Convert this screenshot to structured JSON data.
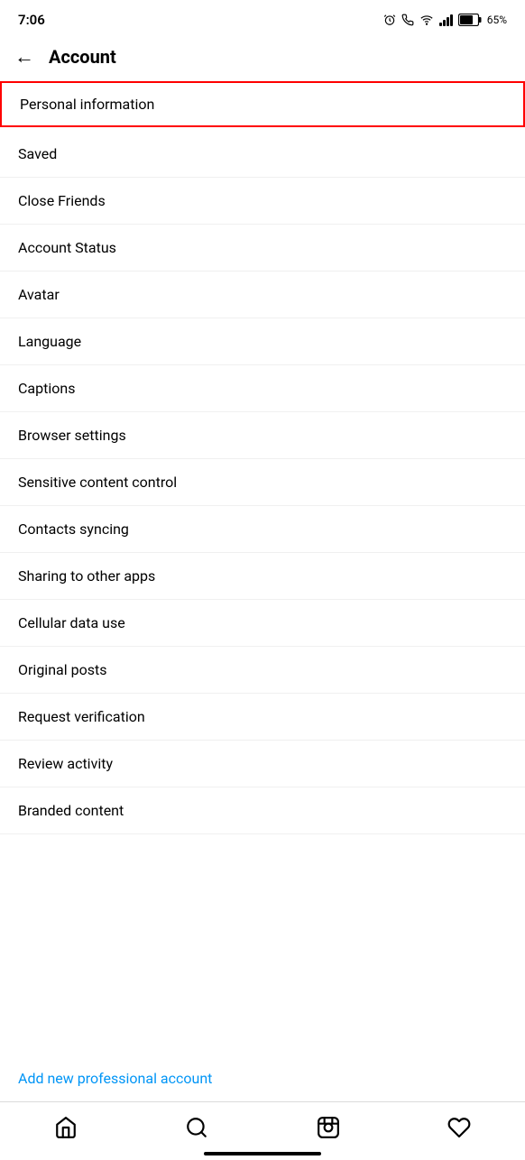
{
  "statusBar": {
    "time": "7:06",
    "battery": "65%"
  },
  "header": {
    "backLabel": "←",
    "title": "Account"
  },
  "menuItems": [
    {
      "id": "personal-information",
      "label": "Personal information",
      "highlighted": true
    },
    {
      "id": "saved",
      "label": "Saved",
      "highlighted": false
    },
    {
      "id": "close-friends",
      "label": "Close Friends",
      "highlighted": false
    },
    {
      "id": "account-status",
      "label": "Account Status",
      "highlighted": false
    },
    {
      "id": "avatar",
      "label": "Avatar",
      "highlighted": false
    },
    {
      "id": "language",
      "label": "Language",
      "highlighted": false
    },
    {
      "id": "captions",
      "label": "Captions",
      "highlighted": false
    },
    {
      "id": "browser-settings",
      "label": "Browser settings",
      "highlighted": false
    },
    {
      "id": "sensitive-content-control",
      "label": "Sensitive content control",
      "highlighted": false
    },
    {
      "id": "contacts-syncing",
      "label": "Contacts syncing",
      "highlighted": false
    },
    {
      "id": "sharing-to-other-apps",
      "label": "Sharing to other apps",
      "highlighted": false
    },
    {
      "id": "cellular-data-use",
      "label": "Cellular data use",
      "highlighted": false
    },
    {
      "id": "original-posts",
      "label": "Original posts",
      "highlighted": false
    },
    {
      "id": "request-verification",
      "label": "Request verification",
      "highlighted": false
    },
    {
      "id": "review-activity",
      "label": "Review activity",
      "highlighted": false
    },
    {
      "id": "branded-content",
      "label": "Branded content",
      "highlighted": false
    }
  ],
  "addProfessional": {
    "label": "Add new professional account"
  },
  "bottomNav": {
    "home": "home",
    "search": "search",
    "reels": "reels",
    "heart": "heart"
  }
}
